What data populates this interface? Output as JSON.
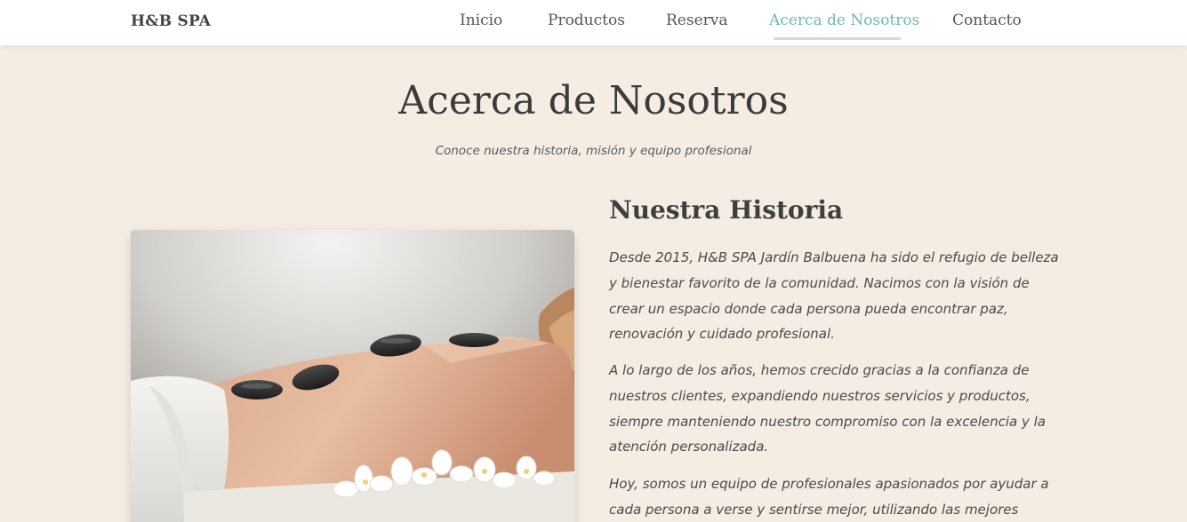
{
  "nav": {
    "brand": "H&B SPA",
    "links": [
      {
        "label": "Inicio",
        "active": false
      },
      {
        "label": "Productos",
        "active": false
      },
      {
        "label": "Reserva",
        "active": false
      },
      {
        "label": "Acerca de Nosotros",
        "active": true
      },
      {
        "label": "Contacto",
        "active": false
      }
    ]
  },
  "header": {
    "title": "Acerca de Nosotros",
    "subtitle": "Conoce nuestra historia, misión y equipo profesional"
  },
  "history": {
    "heading": "Nuestra Historia",
    "paragraphs": [
      "Desde 2015, H&B SPA Jardín Balbuena ha sido el refugio de belleza y bienestar favorito de la comunidad. Nacimos con la visión de crear un espacio donde cada persona pueda encontrar paz, renovación y cuidado profesional.",
      "A lo largo de los años, hemos crecido gracias a la confianza de nuestros clientes, expandiendo nuestros servicios y productos, siempre manteniendo nuestro compromiso con la excelencia y la atención personalizada.",
      "Hoy, somos un equipo de profesionales apasionados por ayudar a cada persona a verse y sentirse mejor, utilizando las mejores técnicas y"
    ]
  },
  "colors": {
    "background": "#f5ece4",
    "navbar": "#ffffff",
    "accent": "#6fb7ba",
    "text": "#3f3f3f"
  }
}
